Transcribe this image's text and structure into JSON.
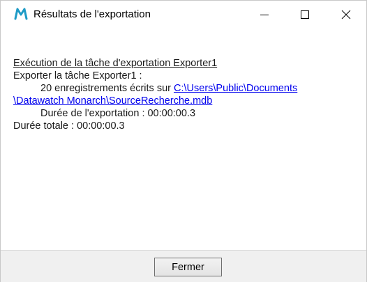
{
  "window": {
    "title": "Résultats de l'exportation",
    "icon": "monarch-m-icon",
    "controls": [
      "minimize-icon",
      "maximize-icon",
      "close-icon"
    ]
  },
  "log": {
    "heading": "Exécution de la tâche d'exportation Exporter1",
    "task_line": "Exporter la tâche Exporter1 :",
    "records_prefix": "20 enregistrements écrits sur ",
    "path_part1": "C:\\Users\\Public\\Documents",
    "path_part2": "\\Datawatch Monarch\\SourceRecherche.mdb",
    "duration_export": "Durée de l'exportation : 00:00:00.3",
    "duration_total": "Durée totale : 00:00:00.3"
  },
  "footer": {
    "close_label": "Fermer"
  },
  "colors": {
    "link": "#0000ee",
    "icon_teal": "#1e9bc6",
    "footer_bg": "#f0f0f0"
  }
}
